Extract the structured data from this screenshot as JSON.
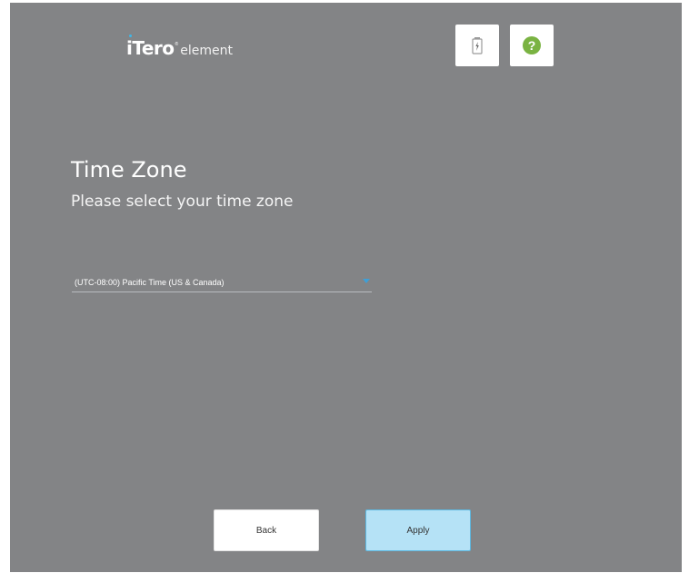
{
  "header": {
    "logo_brand": "iTero",
    "logo_reg": "®",
    "logo_product": "element",
    "battery_icon": "battery-charging-icon",
    "help_icon": "help-icon"
  },
  "page": {
    "title": "Time Zone",
    "subtitle": "Please select your time zone"
  },
  "timezone": {
    "selected": "(UTC-08:00) Pacific Time (US & Canada)"
  },
  "buttons": {
    "back_label": "Back",
    "apply_label": "Apply"
  },
  "colors": {
    "background": "#838486",
    "apply_fill": "#b5e2f6",
    "apply_border": "#5cb8e1",
    "help_green": "#7ab342",
    "dropdown_arrow": "#3f9fd6"
  }
}
